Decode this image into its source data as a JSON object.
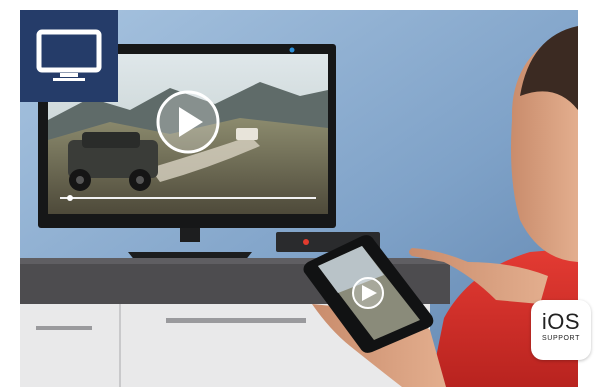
{
  "badges": {
    "tv_icon": "tv-icon",
    "ios": {
      "title": "iOS",
      "subtitle": "SUPPORT"
    }
  },
  "player": {
    "play_icon": "play-icon"
  },
  "colors": {
    "badge_blue": "#253c69",
    "wall_blue": "#8fb0d2",
    "shirt_red": "#d9342e"
  }
}
